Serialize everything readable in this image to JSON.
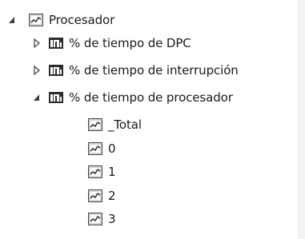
{
  "tree": {
    "root": {
      "label": "Procesador",
      "expanded": true,
      "icon": "line-chart-icon"
    },
    "counters": [
      {
        "label": "% de tiempo de DPC",
        "expanded": false,
        "icon": "instance-counter-icon"
      },
      {
        "label": "% de tiempo de interrupción",
        "expanded": false,
        "icon": "instance-counter-icon"
      },
      {
        "label": "% de tiempo de procesador",
        "expanded": true,
        "icon": "instance-counter-icon"
      }
    ],
    "instances": [
      {
        "label": "_Total",
        "icon": "line-chart-icon"
      },
      {
        "label": "0",
        "icon": "line-chart-icon"
      },
      {
        "label": "1",
        "icon": "line-chart-icon"
      },
      {
        "label": "2",
        "icon": "line-chart-icon"
      },
      {
        "label": "3",
        "icon": "line-chart-icon"
      }
    ]
  }
}
